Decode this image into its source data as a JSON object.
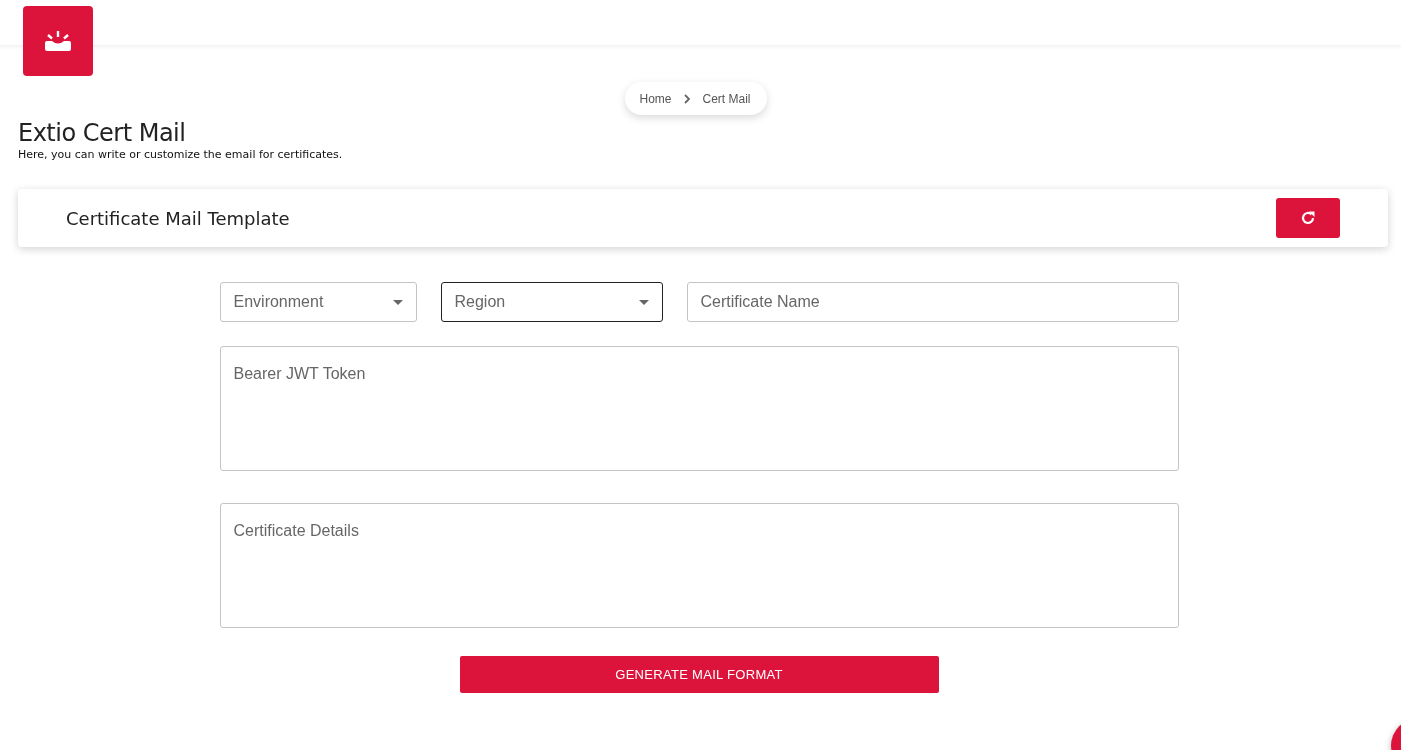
{
  "breadcrumb": [
    {
      "label": "Home"
    },
    {
      "label": "Cert Mail"
    }
  ],
  "page": {
    "title": "Extio Cert Mail",
    "subtitle": "Here, you can write or customize the email for certificates."
  },
  "card": {
    "title": "Certificate Mail Template"
  },
  "fields": [
    {
      "kind": "select",
      "placeholder": "Environment",
      "focused": false
    },
    {
      "kind": "select",
      "placeholder": "Region",
      "focused": true
    },
    {
      "kind": "text",
      "placeholder": "Certificate Name",
      "focused": false
    },
    {
      "kind": "textarea",
      "placeholder": "Bearer JWT Token",
      "focused": false
    },
    {
      "kind": "textarea",
      "placeholder": "Certificate Details",
      "focused": false
    }
  ],
  "submit": {
    "label": "GENERATE MAIL FORMAT"
  }
}
